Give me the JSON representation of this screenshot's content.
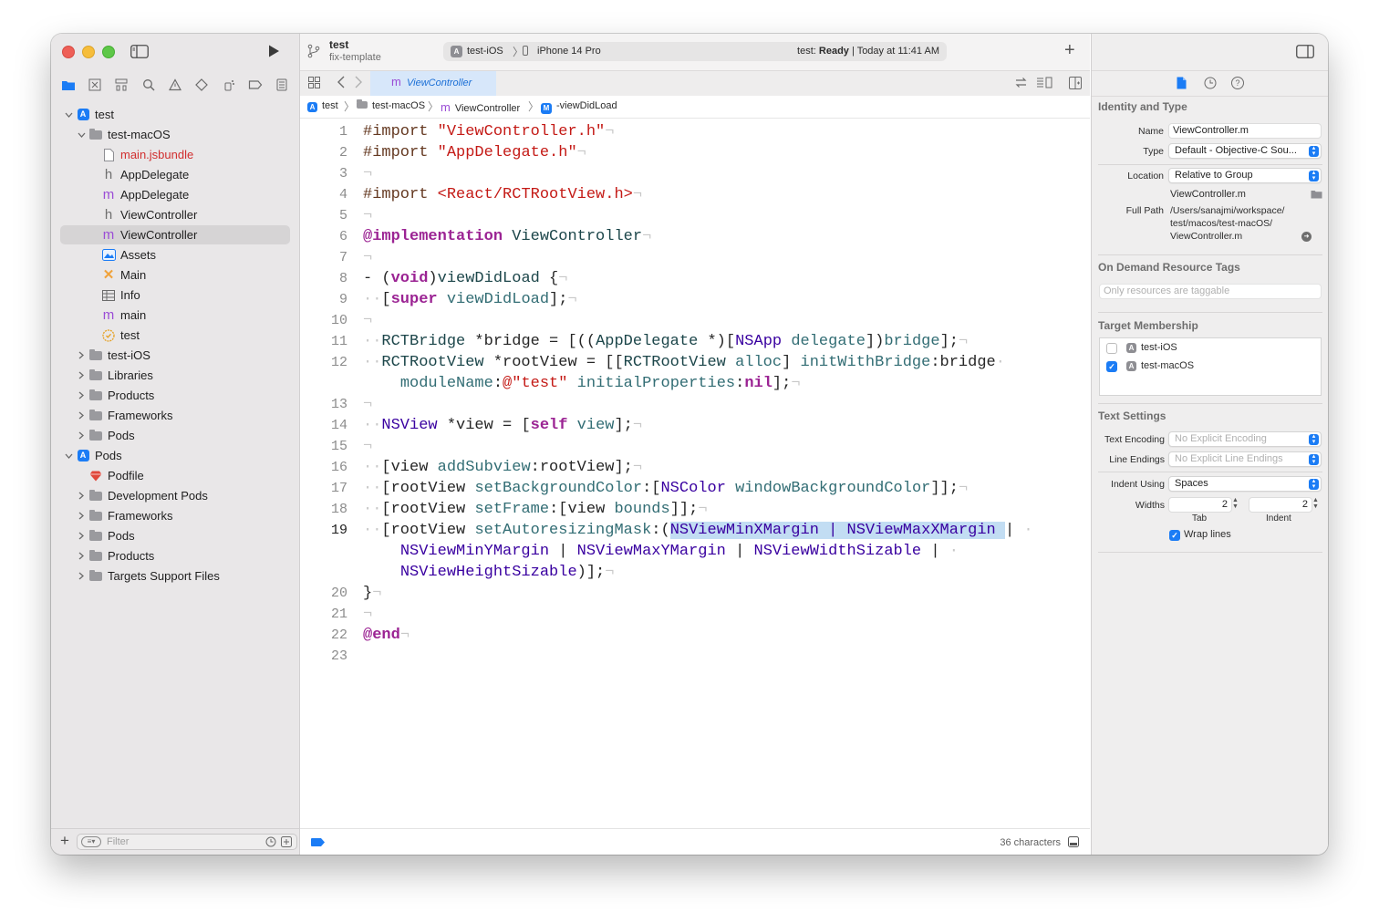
{
  "toolbar": {
    "project_name": "test",
    "branch_name": "fix-template",
    "scheme": "test-iOS",
    "device": "iPhone 14 Pro",
    "status_prefix": "test: ",
    "status_state": "Ready",
    "status_suffix": " | Today at 11:41 AM"
  },
  "sidebar": {
    "filter_placeholder": "Filter",
    "tree": [
      {
        "label": "test",
        "icon": "app-project-icon",
        "indent": 0,
        "disclosure": "open"
      },
      {
        "label": "test-macOS",
        "icon": "folder-icon",
        "indent": 1,
        "disclosure": "open"
      },
      {
        "label": "main.jsbundle",
        "icon": "file-icon",
        "indent": 2,
        "disclosure": "none",
        "red": true
      },
      {
        "label": "AppDelegate",
        "icon": "header-file-icon",
        "indent": 2,
        "disclosure": "none"
      },
      {
        "label": "AppDelegate",
        "icon": "objc-file-icon",
        "indent": 2,
        "disclosure": "none"
      },
      {
        "label": "ViewController",
        "icon": "header-file-icon",
        "indent": 2,
        "disclosure": "none"
      },
      {
        "label": "ViewController",
        "icon": "objc-file-icon",
        "indent": 2,
        "disclosure": "none",
        "selected": true
      },
      {
        "label": "Assets",
        "icon": "asset-catalog-icon",
        "indent": 2,
        "disclosure": "none"
      },
      {
        "label": "Main",
        "icon": "storyboard-icon",
        "indent": 2,
        "disclosure": "none"
      },
      {
        "label": "Info",
        "icon": "plist-table-icon",
        "indent": 2,
        "disclosure": "none"
      },
      {
        "label": "main",
        "icon": "objc-file-icon",
        "indent": 2,
        "disclosure": "none"
      },
      {
        "label": "test",
        "icon": "entitlements-icon",
        "indent": 2,
        "disclosure": "none"
      },
      {
        "label": "test-iOS",
        "icon": "folder-icon",
        "indent": 1,
        "disclosure": "closed"
      },
      {
        "label": "Libraries",
        "icon": "folder-icon",
        "indent": 1,
        "disclosure": "closed"
      },
      {
        "label": "Products",
        "icon": "folder-icon",
        "indent": 1,
        "disclosure": "closed"
      },
      {
        "label": "Frameworks",
        "icon": "folder-icon",
        "indent": 1,
        "disclosure": "closed"
      },
      {
        "label": "Pods",
        "icon": "folder-icon",
        "indent": 1,
        "disclosure": "closed"
      },
      {
        "label": "Pods",
        "icon": "app-project-icon",
        "indent": 0,
        "disclosure": "open"
      },
      {
        "label": "Podfile",
        "icon": "ruby-gem-icon",
        "indent": 1,
        "disclosure": "none"
      },
      {
        "label": "Development Pods",
        "icon": "folder-icon",
        "indent": 1,
        "disclosure": "closed"
      },
      {
        "label": "Frameworks",
        "icon": "folder-icon",
        "indent": 1,
        "disclosure": "closed"
      },
      {
        "label": "Pods",
        "icon": "folder-icon",
        "indent": 1,
        "disclosure": "closed"
      },
      {
        "label": "Products",
        "icon": "folder-icon",
        "indent": 1,
        "disclosure": "closed"
      },
      {
        "label": "Targets Support Files",
        "icon": "folder-icon",
        "indent": 1,
        "disclosure": "closed"
      }
    ]
  },
  "editor": {
    "tab_label": "ViewController",
    "breadcrumb": [
      "test",
      "test-macOS",
      "ViewController",
      "-viewDidLoad"
    ],
    "status_text": "36 characters",
    "code": [
      {
        "n": "1",
        "t": [
          [
            "pp",
            "#import "
          ],
          [
            "str",
            "\"ViewController.h\""
          ],
          [
            "inv",
            "¬"
          ]
        ]
      },
      {
        "n": "2",
        "t": [
          [
            "pp",
            "#import "
          ],
          [
            "str",
            "\"AppDelegate.h\""
          ],
          [
            "inv",
            "¬"
          ]
        ]
      },
      {
        "n": "3",
        "t": [
          [
            "inv",
            "¬"
          ]
        ]
      },
      {
        "n": "4",
        "t": [
          [
            "pp",
            "#import "
          ],
          [
            "str",
            "<React/RCTRootView.h>"
          ],
          [
            "inv",
            "¬"
          ]
        ]
      },
      {
        "n": "5",
        "t": [
          [
            "inv",
            "¬"
          ]
        ]
      },
      {
        "n": "6",
        "t": [
          [
            "kw",
            "@implementation"
          ],
          [
            "pl",
            " "
          ],
          [
            "prj",
            "ViewController"
          ],
          [
            "inv",
            "¬"
          ]
        ]
      },
      {
        "n": "7",
        "t": [
          [
            "inv",
            "¬"
          ]
        ]
      },
      {
        "n": "8",
        "t": [
          [
            "pl",
            "- ("
          ],
          [
            "kw",
            "void"
          ],
          [
            "pl",
            ")"
          ],
          [
            "prj",
            "viewDidLoad"
          ],
          [
            "pl",
            " {"
          ],
          [
            "inv",
            "¬"
          ]
        ]
      },
      {
        "n": "9",
        "t": [
          [
            "inv",
            "··"
          ],
          [
            "pl",
            "["
          ],
          [
            "kw",
            "super"
          ],
          [
            "pl",
            " "
          ],
          [
            "mth",
            "viewDidLoad"
          ],
          [
            "pl",
            "];"
          ],
          [
            "inv",
            "¬"
          ]
        ]
      },
      {
        "n": "10",
        "t": [
          [
            "inv",
            "¬"
          ]
        ]
      },
      {
        "n": "11",
        "t": [
          [
            "inv",
            "··"
          ],
          [
            "prj",
            "RCTBridge"
          ],
          [
            "pl",
            " *bridge = [(("
          ],
          [
            "prj",
            "AppDelegate"
          ],
          [
            "pl",
            " *)["
          ],
          [
            "cls",
            "NSApp"
          ],
          [
            "pl",
            " "
          ],
          [
            "mth",
            "delegate"
          ],
          [
            "pl",
            "])"
          ],
          [
            "mth",
            "bridge"
          ],
          [
            "pl",
            "];"
          ],
          [
            "inv",
            "¬"
          ]
        ]
      },
      {
        "n": "12",
        "t": [
          [
            "inv",
            "··"
          ],
          [
            "prj",
            "RCTRootView"
          ],
          [
            "pl",
            " *rootView = [["
          ],
          [
            "prj",
            "RCTRootView"
          ],
          [
            "pl",
            " "
          ],
          [
            "mth",
            "alloc"
          ],
          [
            "pl",
            "] "
          ],
          [
            "mth",
            "initWithBridge"
          ],
          [
            "pl",
            ":bridge"
          ],
          [
            "inv",
            "·"
          ]
        ]
      },
      {
        "n": "",
        "t": [
          [
            "pl",
            "    "
          ],
          [
            "mth",
            "moduleName"
          ],
          [
            "pl",
            ":"
          ],
          [
            "str",
            "@\"test\""
          ],
          [
            "pl",
            " "
          ],
          [
            "mth",
            "initialProperties"
          ],
          [
            "pl",
            ":"
          ],
          [
            "kw",
            "nil"
          ],
          [
            "pl",
            "];"
          ],
          [
            "inv",
            "¬"
          ]
        ]
      },
      {
        "n": "13",
        "t": [
          [
            "inv",
            "¬"
          ]
        ]
      },
      {
        "n": "14",
        "t": [
          [
            "inv",
            "··"
          ],
          [
            "cls",
            "NSView"
          ],
          [
            "pl",
            " *view = ["
          ],
          [
            "kw",
            "self"
          ],
          [
            "pl",
            " "
          ],
          [
            "mth",
            "view"
          ],
          [
            "pl",
            "];"
          ],
          [
            "inv",
            "¬"
          ]
        ]
      },
      {
        "n": "15",
        "t": [
          [
            "inv",
            "¬"
          ]
        ]
      },
      {
        "n": "16",
        "t": [
          [
            "inv",
            "··"
          ],
          [
            "pl",
            "[view "
          ],
          [
            "mth",
            "addSubview"
          ],
          [
            "pl",
            ":rootView];"
          ],
          [
            "inv",
            "¬"
          ]
        ]
      },
      {
        "n": "17",
        "t": [
          [
            "inv",
            "··"
          ],
          [
            "pl",
            "[rootView "
          ],
          [
            "mth",
            "setBackgroundColor"
          ],
          [
            "pl",
            ":["
          ],
          [
            "cls",
            "NSColor"
          ],
          [
            "pl",
            " "
          ],
          [
            "mth",
            "windowBackgroundColor"
          ],
          [
            "pl",
            "]];"
          ],
          [
            "inv",
            "¬"
          ]
        ]
      },
      {
        "n": "18",
        "t": [
          [
            "inv",
            "··"
          ],
          [
            "pl",
            "[rootView "
          ],
          [
            "mth",
            "setFrame"
          ],
          [
            "pl",
            ":[view "
          ],
          [
            "mth",
            "bounds"
          ],
          [
            "pl",
            "]];"
          ],
          [
            "inv",
            "¬"
          ]
        ]
      },
      {
        "n": "19",
        "cur": true,
        "t": [
          [
            "inv",
            "··"
          ],
          [
            "pl",
            "[rootView "
          ],
          [
            "mth",
            "setAutoresizingMask"
          ],
          [
            "pl",
            ":("
          ],
          [
            "hlc",
            "NSViewMinXMargin | NSViewMaxXMargin "
          ],
          [
            "pl",
            "| "
          ],
          [
            "inv",
            "·"
          ]
        ]
      },
      {
        "n": "",
        "t": [
          [
            "pl",
            "    "
          ],
          [
            "cls",
            "NSViewMinYMargin"
          ],
          [
            "pl",
            " | "
          ],
          [
            "cls",
            "NSViewMaxYMargin"
          ],
          [
            "pl",
            " | "
          ],
          [
            "cls",
            "NSViewWidthSizable"
          ],
          [
            "pl",
            " | "
          ],
          [
            "inv",
            "·"
          ]
        ]
      },
      {
        "n": "",
        "t": [
          [
            "pl",
            "    "
          ],
          [
            "cls",
            "NSViewHeightSizable"
          ],
          [
            "pl",
            ")];"
          ],
          [
            "inv",
            "¬"
          ]
        ]
      },
      {
        "n": "20",
        "t": [
          [
            "pl",
            "}"
          ],
          [
            "inv",
            "¬"
          ]
        ]
      },
      {
        "n": "21",
        "t": [
          [
            "inv",
            "¬"
          ]
        ]
      },
      {
        "n": "22",
        "t": [
          [
            "kw",
            "@end"
          ],
          [
            "inv",
            "¬"
          ]
        ]
      },
      {
        "n": "23",
        "t": []
      }
    ]
  },
  "inspector": {
    "identity_title": "Identity and Type",
    "name_label": "Name",
    "name_value": "ViewController.m",
    "type_label": "Type",
    "type_value": "Default - Objective-C Sou...",
    "location_label": "Location",
    "location_value": "Relative to Group",
    "location_file": "ViewController.m",
    "fullpath_label": "Full Path",
    "fullpath_line1": "/Users/sanajmi/workspace/",
    "fullpath_line2": "test/macos/test-macOS/",
    "fullpath_line3": "ViewController.m",
    "odr_title": "On Demand Resource Tags",
    "odr_placeholder": "Only resources are taggable",
    "target_title": "Target Membership",
    "targets": [
      {
        "name": "test-iOS",
        "checked": false
      },
      {
        "name": "test-macOS",
        "checked": true
      }
    ],
    "text_title": "Text Settings",
    "encoding_label": "Text Encoding",
    "encoding_value": "No Explicit Encoding",
    "endings_label": "Line Endings",
    "endings_value": "No Explicit Line Endings",
    "indent_label": "Indent Using",
    "indent_value": "Spaces",
    "widths_label": "Widths",
    "tab_width": "2",
    "indent_width": "2",
    "tab_caption": "Tab",
    "indent_caption": "Indent",
    "wrap_label": "Wrap lines",
    "wrap_checked": true
  },
  "colors": {
    "accent": "#1b7cf5",
    "keyword": "#9b2393",
    "string": "#c41a16",
    "class": "#3900a0",
    "method": "#326d74"
  }
}
